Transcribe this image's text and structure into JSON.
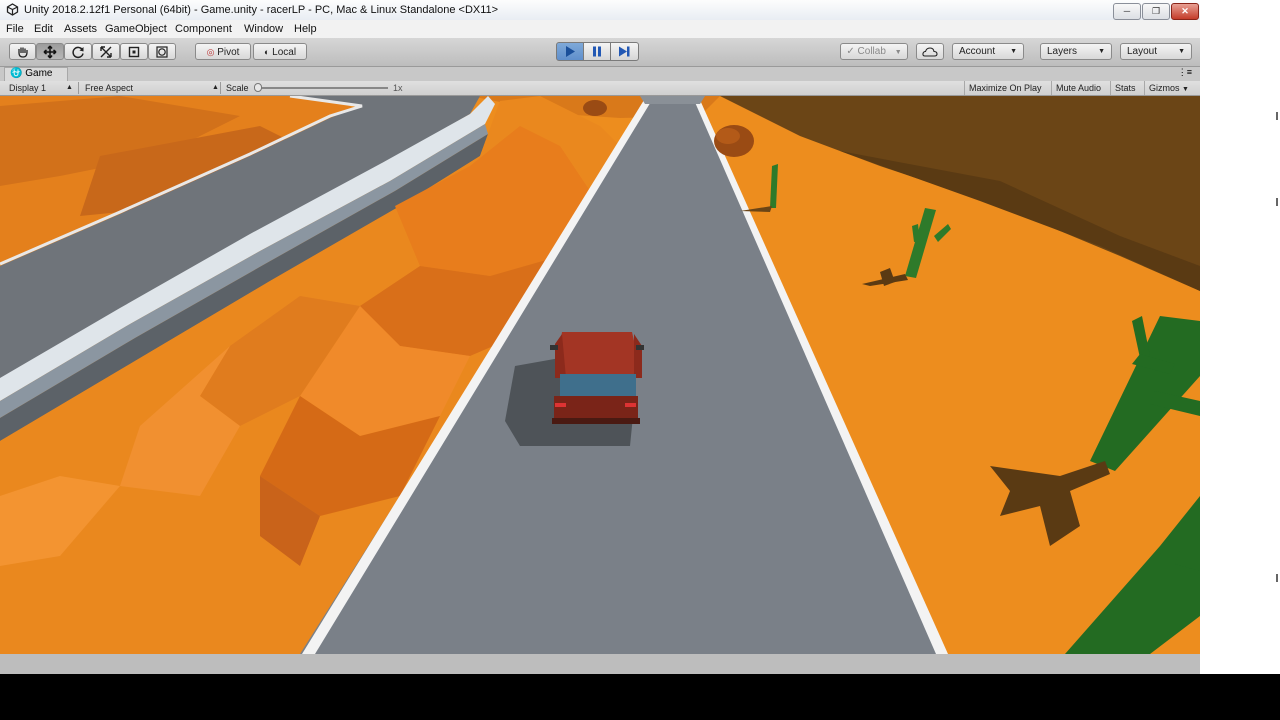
{
  "window": {
    "title": "Unity 2018.2.12f1 Personal (64bit) - Game.unity - racerLP - PC, Mac & Linux Standalone <DX11>",
    "controls": [
      "minimize-icon",
      "restore-icon",
      "close-icon"
    ]
  },
  "menu": [
    "File",
    "Edit",
    "Assets",
    "GameObject",
    "Component",
    "Window",
    "Help"
  ],
  "toolbar": {
    "tools": [
      "hand-tool-icon",
      "move-tool-icon",
      "rotate-tool-icon",
      "scale-tool-icon",
      "rect-tool-icon",
      "transform-tool-icon"
    ],
    "active_tool": "move-tool-icon",
    "pivot_label": "Pivot",
    "local_label": "Local",
    "playback": {
      "play_active": true,
      "pause_active": false
    },
    "collab_label": "Collab",
    "account_label": "Account",
    "layers_label": "Layers",
    "layout_label": "Layout"
  },
  "game_view": {
    "tab_label": "Game",
    "display_label": "Display 1",
    "aspect_label": "Free Aspect",
    "scale_label": "Scale",
    "scale_value": "1x",
    "maximize_label": "Maximize On Play",
    "mute_label": "Mute Audio",
    "stats_label": "Stats",
    "gizmos_label": "Gizmos"
  },
  "colors": {
    "sand": "#ed8d1e",
    "sand_dark": "#6b4516",
    "rock": "#e07a1a",
    "road": "#7a8088",
    "road_line": "#f3f3f3",
    "cactus": "#236b22",
    "car_body": "#a33524",
    "car_window": "#3f6f8c",
    "play_active": "#5f8fcc"
  }
}
